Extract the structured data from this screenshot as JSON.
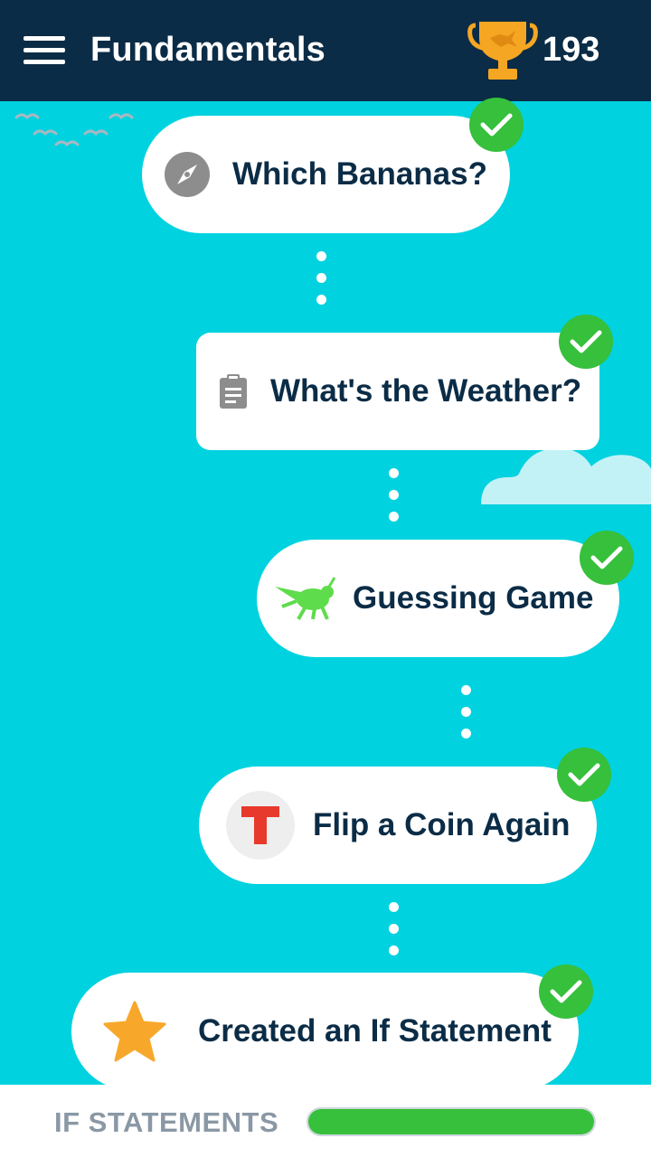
{
  "header": {
    "title": "Fundamentals",
    "score": "193"
  },
  "lessons": [
    {
      "label": "Which Bananas?",
      "icon": "compass-icon",
      "completed": true
    },
    {
      "label": "What's the Weather?",
      "icon": "clipboard-icon",
      "completed": true
    },
    {
      "label": "Guessing Game",
      "icon": "grasshopper-icon",
      "completed": true
    },
    {
      "label": "Flip a Coin Again",
      "icon": "t-logo-icon",
      "completed": true
    },
    {
      "label": "Created an If Statement",
      "icon": "star-icon",
      "completed": true
    }
  ],
  "footer": {
    "section_label": "IF STATEMENTS",
    "progress": 1.0
  },
  "colors": {
    "header_bg": "#0b2c46",
    "background": "#00d2df",
    "check_green": "#36c03b",
    "trophy_gold": "#f5a623"
  }
}
